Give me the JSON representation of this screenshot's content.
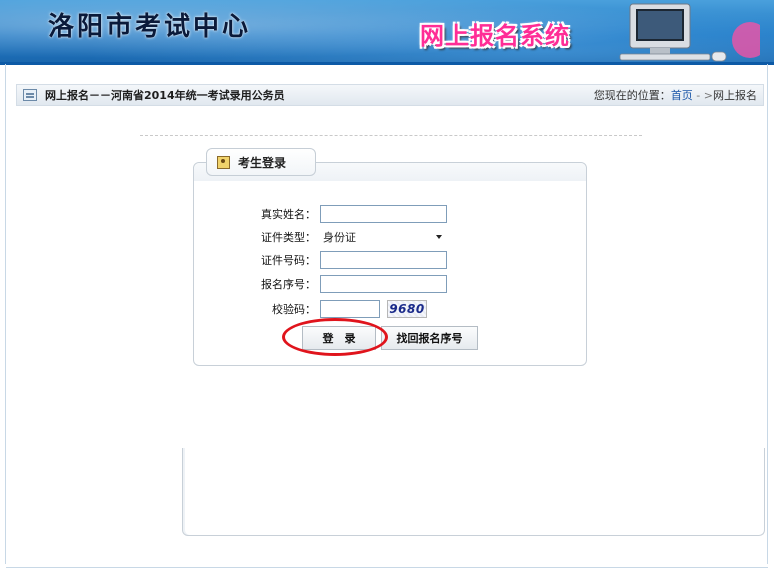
{
  "banner": {
    "title": "洛阳市考试中心",
    "system_name": "网上报名系统",
    "computer_icon": "computer-icon"
  },
  "navbar": {
    "icon": "list-icon",
    "title": "网上报名－－河南省2014年统一考试录用公务员",
    "location_label": "您现在的位置：",
    "home_link": "首页",
    "separator": " - >",
    "current": "网上报名"
  },
  "login": {
    "tab_icon": "user-card-icon",
    "tab_label": "考生登录",
    "fields": {
      "name_label": "真实姓名：",
      "name_value": "",
      "id_type_label": "证件类型：",
      "id_type_value": "身份证",
      "id_number_label": "证件号码：",
      "id_number_value": "",
      "reg_number_label": "报名序号：",
      "reg_number_value": "",
      "captcha_label": "校验码：",
      "captcha_value": "",
      "captcha_image_text": "9680"
    },
    "buttons": {
      "login": "登　录",
      "recover": "找回报名序号"
    }
  },
  "colors": {
    "banner_blue": "#1f78c4",
    "link_blue": "#1a56a8",
    "highlight_red": "#e0141c",
    "system_pink": "#ff2d96"
  }
}
